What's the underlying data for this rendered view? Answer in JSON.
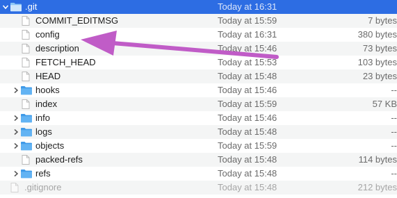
{
  "rows": [
    {
      "name": ".git",
      "date": "Today at 16:31",
      "size": "",
      "kind": "folder",
      "expanded": true
    },
    {
      "name": "COMMIT_EDITMSG",
      "date": "Today at 15:59",
      "size": "7 bytes",
      "kind": "file"
    },
    {
      "name": "config",
      "date": "Today at 16:31",
      "size": "380 bytes",
      "kind": "file"
    },
    {
      "name": "description",
      "date": "Today at 15:46",
      "size": "73 bytes",
      "kind": "file"
    },
    {
      "name": "FETCH_HEAD",
      "date": "Today at 15:53",
      "size": "103 bytes",
      "kind": "file"
    },
    {
      "name": "HEAD",
      "date": "Today at 15:48",
      "size": "23 bytes",
      "kind": "file"
    },
    {
      "name": "hooks",
      "date": "Today at 15:46",
      "size": "--",
      "kind": "folder"
    },
    {
      "name": "index",
      "date": "Today at 15:59",
      "size": "57 KB",
      "kind": "file"
    },
    {
      "name": "info",
      "date": "Today at 15:46",
      "size": "--",
      "kind": "folder"
    },
    {
      "name": "logs",
      "date": "Today at 15:48",
      "size": "--",
      "kind": "folder"
    },
    {
      "name": "objects",
      "date": "Today at 15:59",
      "size": "--",
      "kind": "folder"
    },
    {
      "name": "packed-refs",
      "date": "Today at 15:48",
      "size": "114 bytes",
      "kind": "file"
    },
    {
      "name": "refs",
      "date": "Today at 15:48",
      "size": "--",
      "kind": "folder"
    },
    {
      "name": ".gitignore",
      "date": "Today at 15:48",
      "size": "212 bytes",
      "kind": "file"
    }
  ],
  "colors": {
    "selection": "#2d6de3",
    "folder": "#5fb0f1",
    "arrow": "#c05cc7"
  },
  "icons": {
    "folder": "folder-icon",
    "file": "document-icon",
    "disclosure_closed": "chevron-right-icon",
    "disclosure_open": "chevron-down-icon"
  }
}
